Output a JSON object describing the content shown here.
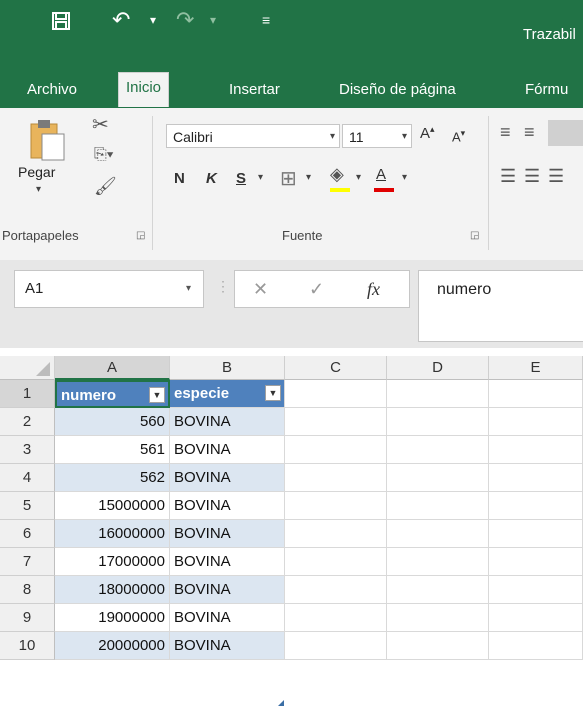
{
  "app": {
    "title": "Trazabil",
    "qat": {
      "save_icon": "🖫",
      "undo_icon": "↶",
      "redo_icon": "↷",
      "customize_icon": "≡"
    }
  },
  "tabs": [
    {
      "label": "Archivo"
    },
    {
      "label": "Inicio"
    },
    {
      "label": "Insertar"
    },
    {
      "label": "Diseño de página"
    },
    {
      "label": "Fórmu"
    }
  ],
  "ribbon": {
    "clipboard": {
      "paste_label": "Pegar",
      "group_label": "Portapapeles"
    },
    "font": {
      "font_name": "Calibri",
      "font_size": "11",
      "bold": "N",
      "italic": "K",
      "underline": "S",
      "group_label": "Fuente"
    }
  },
  "formula_bar": {
    "name_box": "A1",
    "fx_label": "fx",
    "content": "numero"
  },
  "sheet": {
    "columns": [
      "A",
      "B",
      "C",
      "D",
      "E"
    ],
    "rows": [
      {
        "num": "1",
        "a": "numero",
        "b": "especie"
      },
      {
        "num": "2",
        "a": "560",
        "b": "BOVINA"
      },
      {
        "num": "3",
        "a": "561",
        "b": "BOVINA"
      },
      {
        "num": "4",
        "a": "562",
        "b": "BOVINA"
      },
      {
        "num": "5",
        "a": "15000000",
        "b": "BOVINA"
      },
      {
        "num": "6",
        "a": "16000000",
        "b": "BOVINA"
      },
      {
        "num": "7",
        "a": "17000000",
        "b": "BOVINA"
      },
      {
        "num": "8",
        "a": "18000000",
        "b": "BOVINA"
      },
      {
        "num": "9",
        "a": "19000000",
        "b": "BOVINA"
      },
      {
        "num": "10",
        "a": "20000000",
        "b": "BOVINA"
      }
    ]
  }
}
